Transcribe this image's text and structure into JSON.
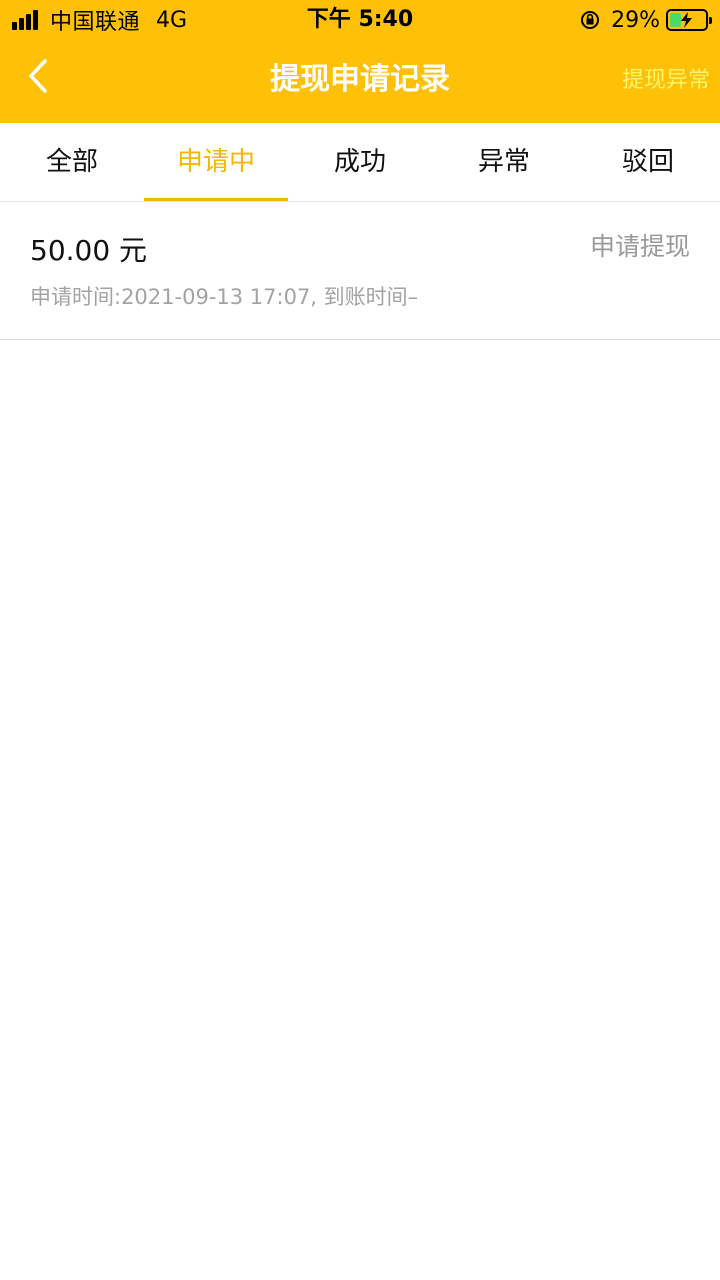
{
  "status_bar": {
    "carrier": "中国联通",
    "network": "4G",
    "time": "下午 5:40",
    "battery": "29%"
  },
  "header": {
    "title": "提现申请记录",
    "right_action": "提现异常"
  },
  "tabs": [
    {
      "label": "全部"
    },
    {
      "label": "申请中"
    },
    {
      "label": "成功"
    },
    {
      "label": "异常"
    },
    {
      "label": "驳回"
    }
  ],
  "active_tab": "申请中",
  "records": [
    {
      "amount": "50.00 元",
      "status": "申请提现",
      "times": "申请时间:2021-09-13 17:07, 到账时间–"
    }
  ],
  "colors": {
    "header_bg": "#FFC107",
    "accent": "#F5B800",
    "right_action": "#FFF66B"
  }
}
